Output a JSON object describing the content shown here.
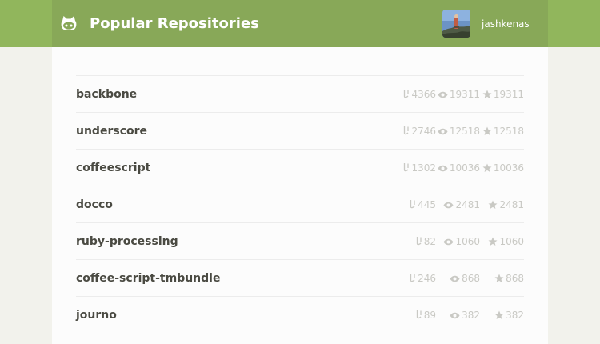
{
  "header": {
    "title": "Popular Repositories",
    "username": "jashkenas",
    "logo_icon": "octocat-icon",
    "avatar": "user-avatar"
  },
  "colors": {
    "topbar": "#91b65c",
    "topbar_inner": "#88a858",
    "page_background": "#f2f2ec",
    "content_background": "#fcfcfc",
    "repo_name": "#4a4a42",
    "stats": "#c9c9c4"
  },
  "icons": {
    "forks": "fork-icon",
    "watchers": "eye-icon",
    "stars": "star-icon"
  },
  "repos": [
    {
      "name": "backbone",
      "forks": "4366",
      "watchers": "19311",
      "stars": "19311"
    },
    {
      "name": "underscore",
      "forks": "2746",
      "watchers": "12518",
      "stars": "12518"
    },
    {
      "name": "coffeescript",
      "forks": "1302",
      "watchers": "10036",
      "stars": "10036"
    },
    {
      "name": "docco",
      "forks": "445",
      "watchers": "2481",
      "stars": "2481"
    },
    {
      "name": "ruby-processing",
      "forks": "82",
      "watchers": "1060",
      "stars": "1060"
    },
    {
      "name": "coffee-script-tmbundle",
      "forks": "246",
      "watchers": "868",
      "stars": "868"
    },
    {
      "name": "journo",
      "forks": "89",
      "watchers": "382",
      "stars": "382"
    }
  ]
}
